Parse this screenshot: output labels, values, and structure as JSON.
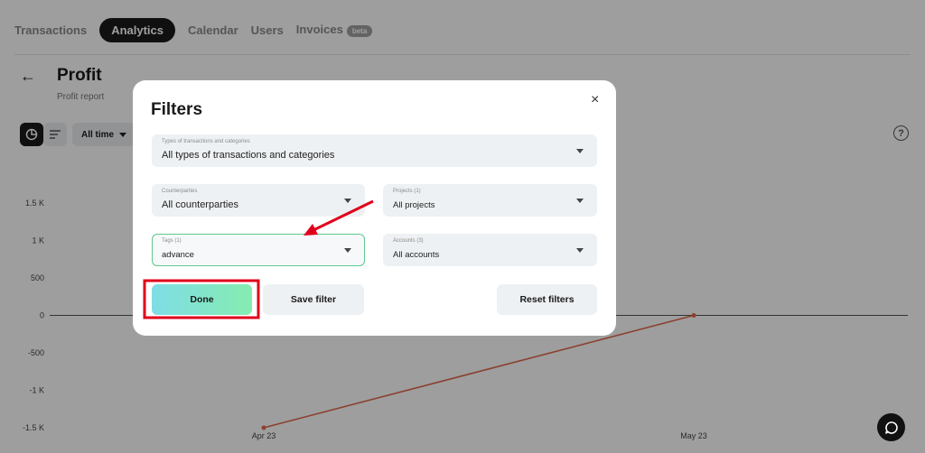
{
  "nav": {
    "tabs": [
      {
        "label": "Transactions"
      },
      {
        "label": "Analytics"
      },
      {
        "label": "Calendar"
      },
      {
        "label": "Users"
      },
      {
        "label": "Invoices",
        "badge": "beta"
      }
    ],
    "active_index": 1
  },
  "page": {
    "title": "Profit",
    "subtitle": "Profit report",
    "period": "All time",
    "help": "?"
  },
  "chart_data": {
    "type": "line",
    "x": [
      "Apr 23",
      "May 23"
    ],
    "series": [
      {
        "values": [
          -1500,
          0
        ]
      }
    ],
    "yticks": [
      "1.5 K",
      "1 K",
      "500",
      "0",
      "-500",
      "-1 K",
      "-1.5 K"
    ],
    "ytick_values": [
      1500,
      1000,
      500,
      0,
      -500,
      -1000,
      -1500
    ],
    "ylim": [
      -1500,
      1500
    ],
    "line_color": "#e06a4e",
    "grid": false
  },
  "modal": {
    "title": "Filters",
    "close": "×",
    "fields": {
      "types": {
        "label": "Types of transactions and categories",
        "value": "All types of transactions and categories"
      },
      "counterparties": {
        "label": "Counterparties",
        "value": "All counterparties"
      },
      "projects": {
        "label": "Projects (1)",
        "value": "All projects"
      },
      "tags": {
        "label": "Tags (1)",
        "value": "advance"
      },
      "accounts": {
        "label": "Accounts (3)",
        "value": "All accounts"
      }
    },
    "buttons": {
      "done": "Done",
      "save": "Save filter",
      "reset": "Reset filters"
    }
  },
  "colors": {
    "accent_gradient_start": "#7fdde6",
    "accent_gradient_end": "#85ecb0",
    "highlight_border": "#5fca8e",
    "annotation_red": "#e0001b"
  },
  "icons": {
    "back": "arrow-left-icon",
    "pie": "pie-chart-icon",
    "list": "list-icon",
    "help": "help-icon",
    "close": "close-icon",
    "chat": "chat-icon"
  }
}
